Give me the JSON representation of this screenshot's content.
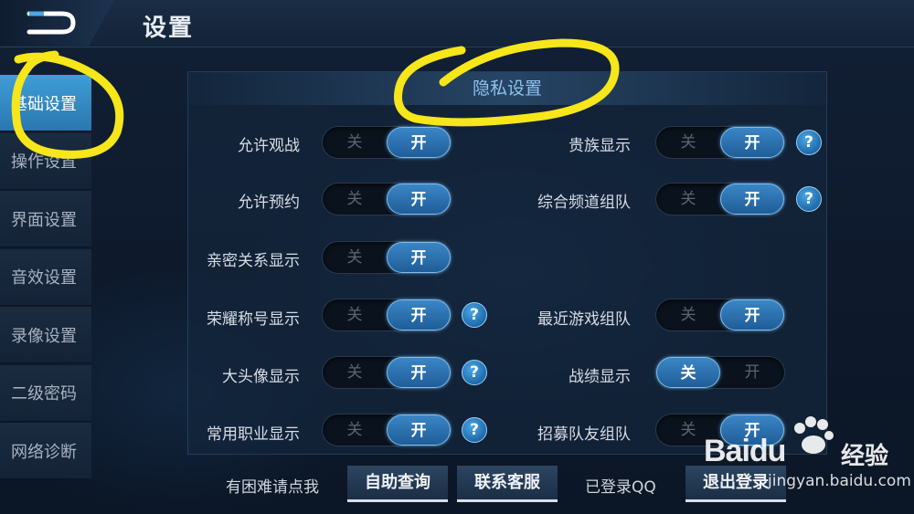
{
  "header": {
    "title": "设置"
  },
  "sidebar": {
    "items": [
      {
        "label": "基础设置",
        "active": true
      },
      {
        "label": "操作设置",
        "active": false
      },
      {
        "label": "界面设置",
        "active": false
      },
      {
        "label": "音效设置",
        "active": false
      },
      {
        "label": "录像设置",
        "active": false
      },
      {
        "label": "二级密码",
        "active": false
      },
      {
        "label": "网络诊断",
        "active": false
      }
    ]
  },
  "panel": {
    "title": "隐私设置",
    "off_label": "关",
    "on_label": "开",
    "help_label": "?",
    "left": [
      {
        "label": "允许观战",
        "state": "on",
        "help": false
      },
      {
        "label": "允许预约",
        "state": "on",
        "help": false
      },
      {
        "label": "亲密关系显示",
        "state": "on",
        "help": false
      },
      {
        "label": "荣耀称号显示",
        "state": "on",
        "help": true
      },
      {
        "label": "大头像显示",
        "state": "on",
        "help": true
      },
      {
        "label": "常用职业显示",
        "state": "on",
        "help": true
      }
    ],
    "right": [
      {
        "label": "贵族显示",
        "state": "on",
        "help": true
      },
      {
        "label": "综合频道组队",
        "state": "on",
        "help": true
      },
      {
        "label": "",
        "state": "",
        "help": false
      },
      {
        "label": "最近游戏组队",
        "state": "on",
        "help": false
      },
      {
        "label": "战绩显示",
        "state": "off",
        "help": false
      },
      {
        "label": "招募队友组队",
        "state": "on",
        "help": false
      }
    ]
  },
  "footer": {
    "help_text": "有困难请点我",
    "self_service_button": "自助查询",
    "contact_button": "联系客服",
    "login_status": "已登录QQ",
    "logout_button": "退出登录"
  },
  "watermark": {
    "brand": "Baidu",
    "suffix": "经验",
    "url": "jingyan.baidu.com"
  },
  "colors": {
    "accent": "#3b86c6",
    "active_tab": "#3f9ed6",
    "annotation": "#f6e61a"
  }
}
